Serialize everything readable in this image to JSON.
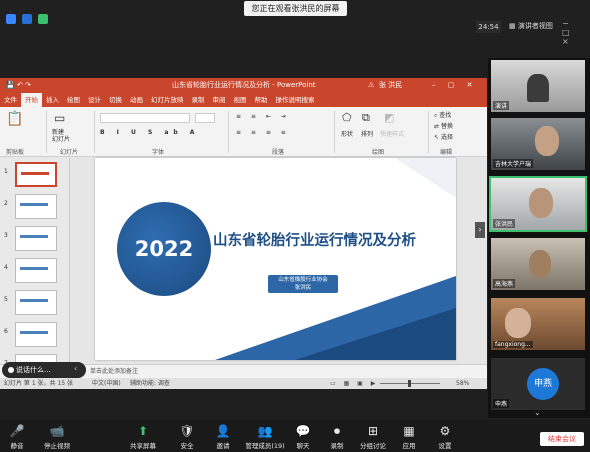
{
  "meeting": {
    "share_banner": "您正在观看张洪民的屏幕",
    "clock": "24:54",
    "view_toggle": "演讲者视图",
    "window_controls": "− □ ×"
  },
  "ppt": {
    "title": "山东省轮胎行业运行情况及分析  -  PowerPoint",
    "user": "张 洪民",
    "menu": [
      "文件",
      "开始",
      "插入",
      "绘图",
      "设计",
      "切换",
      "动画",
      "幻灯片放映",
      "录制",
      "审阅",
      "视图",
      "帮助",
      "操作说明搜索"
    ],
    "ribbon": {
      "groups": [
        "剪贴板",
        "幻灯片",
        "字体",
        "段落",
        "绘图",
        "编辑"
      ],
      "new_slide": "新建\n幻灯片",
      "shape": "形状",
      "arrange": "排列",
      "quick_style": "快速样式",
      "find": "查找",
      "replace": "替换",
      "select": "选择"
    },
    "slide_numbers": [
      "1",
      "2",
      "3",
      "4",
      "5",
      "6",
      "7"
    ],
    "notes_placeholder": "单击此处添加备注",
    "status": {
      "slide_of": "幻灯片 第 1 张，共 15 张",
      "language": "中文(中国)",
      "accessibility": "辅助功能: 调查",
      "zoom": "58%"
    }
  },
  "slide": {
    "year": "2022",
    "title": "山东省轮胎行业运行情况及分析",
    "org_line1": "山东省橡胶行业协会",
    "org_line2": "张洪民"
  },
  "speaking_label": "说话什么...",
  "participants": [
    {
      "name": "演讲"
    },
    {
      "name": "吉林大学户瑞"
    },
    {
      "name": "张洪民"
    },
    {
      "name": "高海燕"
    },
    {
      "name": "fangxiong..."
    },
    {
      "name": "申燕",
      "avatar_text": "申燕"
    }
  ],
  "toolbar": {
    "items": [
      "静音",
      "停止视频",
      "共享屏幕",
      "安全",
      "邀请",
      "管理成员(19)",
      "聊天",
      "录制",
      "分组讨论",
      "应用",
      "设置"
    ],
    "end": "结束会议"
  },
  "colors": {
    "ppt_accent": "#c9452b",
    "slide_blue": "#1e4f86",
    "active_speaker": "#3cbf6e"
  }
}
